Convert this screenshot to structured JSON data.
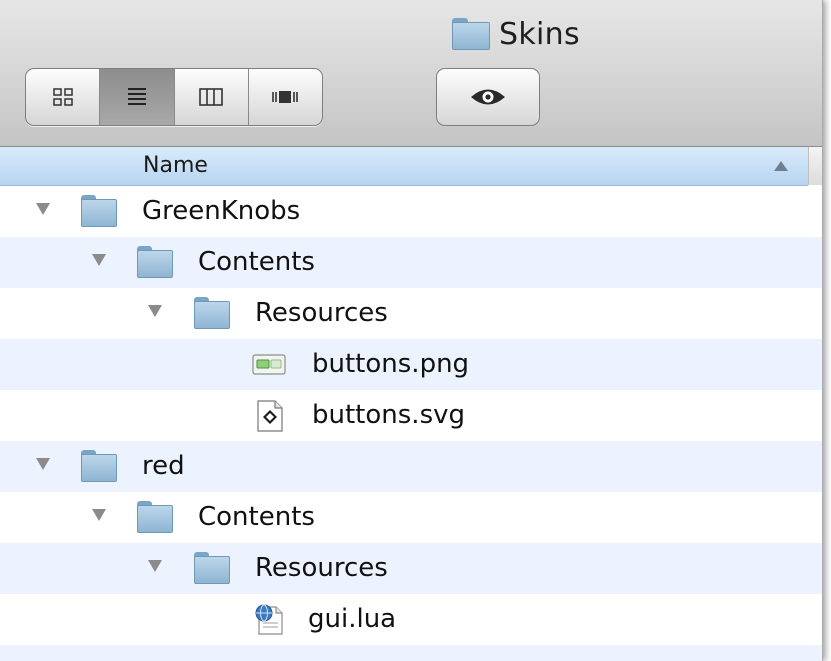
{
  "window": {
    "title": "Skins"
  },
  "toolbar": {
    "view_modes": [
      {
        "name": "icon-view",
        "active": false
      },
      {
        "name": "list-view",
        "active": true
      },
      {
        "name": "column-view",
        "active": false
      },
      {
        "name": "cover-flow-view",
        "active": false
      }
    ],
    "quick_look_icon": "eye-icon"
  },
  "list": {
    "column_header": "Name",
    "sort": "ascending",
    "rows": [
      {
        "label": "GreenKnobs",
        "depth": 0,
        "type": "folder",
        "expanded": true
      },
      {
        "label": "Contents",
        "depth": 1,
        "type": "folder",
        "expanded": true
      },
      {
        "label": "Resources",
        "depth": 2,
        "type": "folder",
        "expanded": true
      },
      {
        "label": "buttons.png",
        "depth": 3,
        "type": "png-file"
      },
      {
        "label": "buttons.svg",
        "depth": 3,
        "type": "svg-file"
      },
      {
        "label": "red",
        "depth": 0,
        "type": "folder",
        "expanded": true
      },
      {
        "label": "Contents",
        "depth": 1,
        "type": "folder",
        "expanded": true
      },
      {
        "label": "Resources",
        "depth": 2,
        "type": "folder",
        "expanded": true
      },
      {
        "label": "gui.lua",
        "depth": 3,
        "type": "lua-file"
      }
    ]
  },
  "colors": {
    "row_alt": "#edf3fe",
    "header": "#c4dcf4",
    "folder": "#a6c6e0"
  }
}
